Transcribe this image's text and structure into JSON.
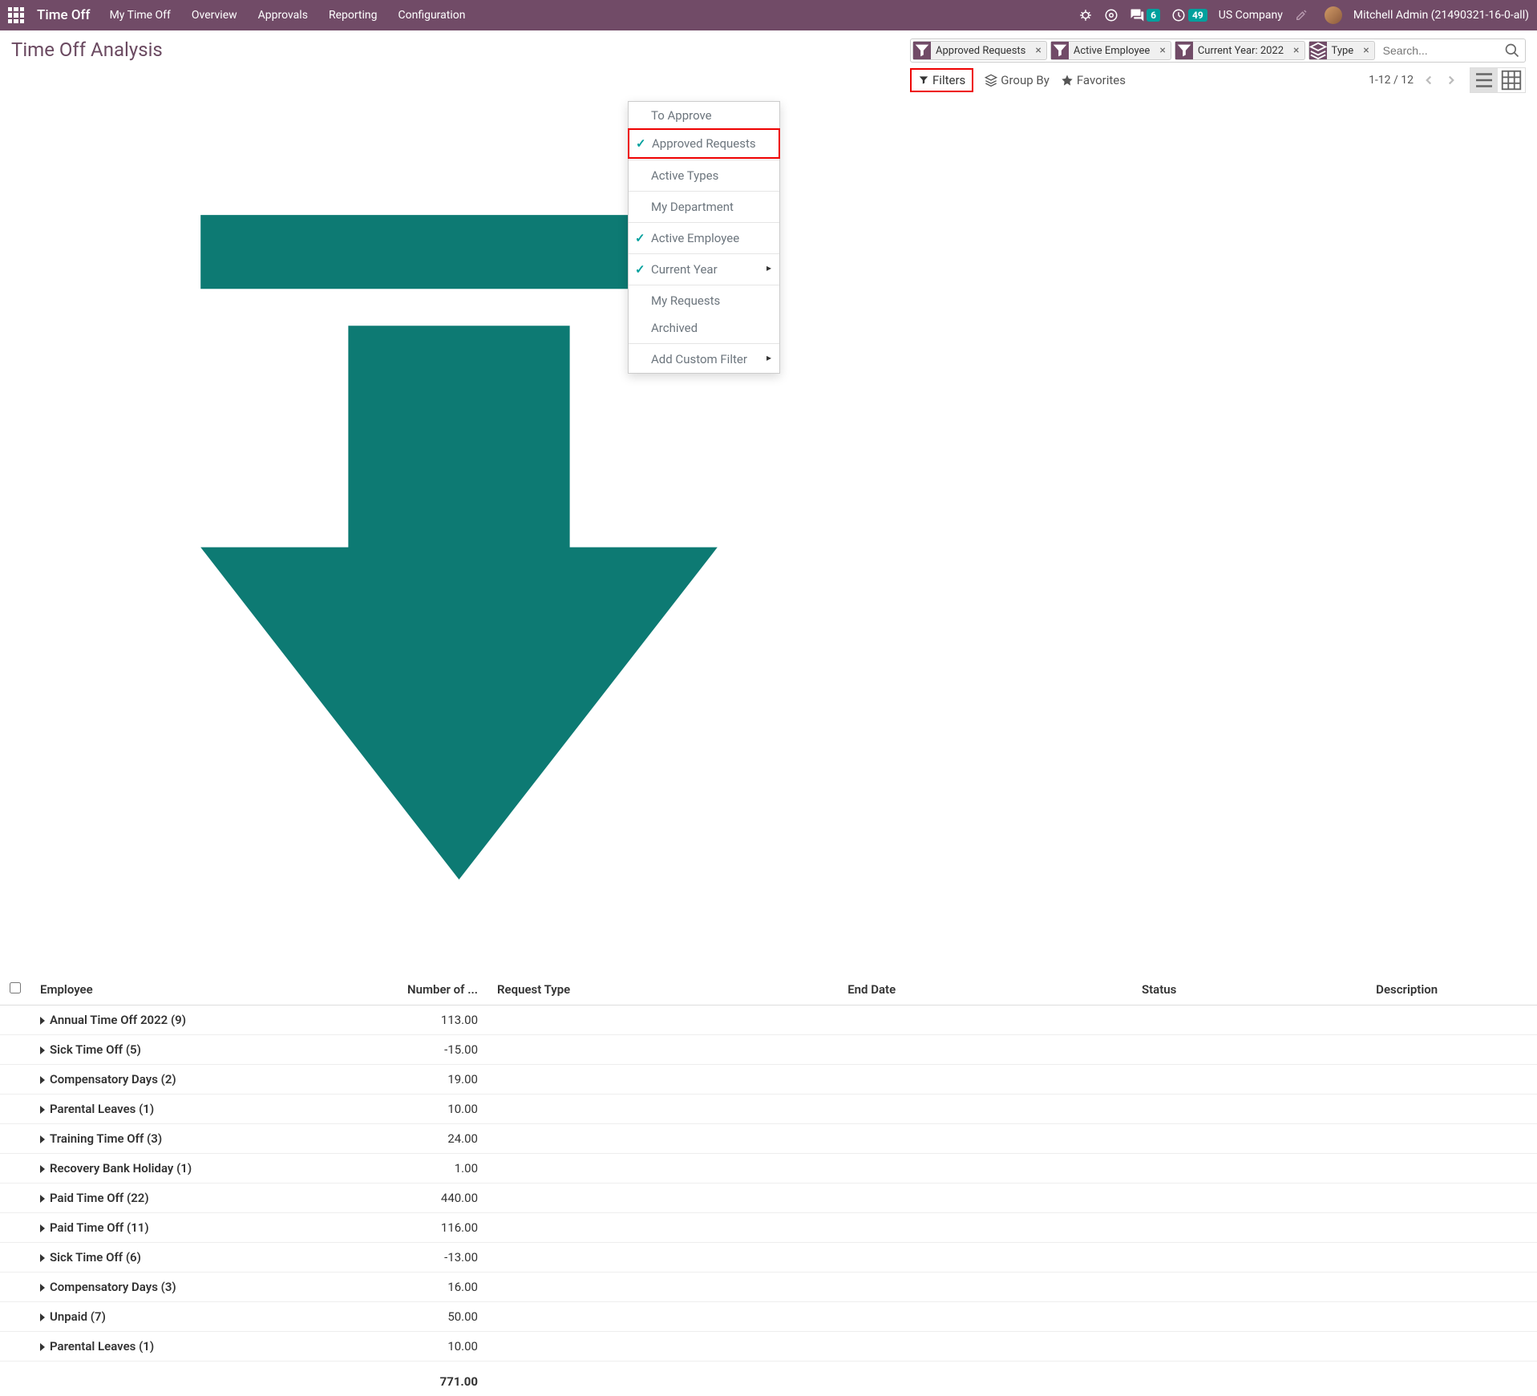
{
  "topbar": {
    "app_name": "Time Off",
    "menu": [
      "My Time Off",
      "Overview",
      "Approvals",
      "Reporting",
      "Configuration"
    ],
    "chat_count": "6",
    "activity_count": "49",
    "company": "US Company",
    "user": "Mitchell Admin (21490321-16-0-all)"
  },
  "page": {
    "title": "Time Off Analysis"
  },
  "search": {
    "facets": [
      {
        "type": "filter",
        "label": "Approved Requests"
      },
      {
        "type": "filter",
        "label": "Active Employee"
      },
      {
        "type": "filter",
        "label": "Current Year: 2022"
      },
      {
        "type": "group",
        "label": "Type"
      }
    ],
    "placeholder": "Search..."
  },
  "toolbar": {
    "filters_label": "Filters",
    "groupby_label": "Group By",
    "favorites_label": "Favorites",
    "pager": "1-12 / 12"
  },
  "filter_menu": {
    "items": [
      {
        "label": "To Approve",
        "checked": false
      },
      {
        "label": "Approved Requests",
        "checked": true,
        "highlight": true
      },
      {
        "sep": true
      },
      {
        "label": "Active Types",
        "checked": false
      },
      {
        "sep": true
      },
      {
        "label": "My Department",
        "checked": false
      },
      {
        "sep": true
      },
      {
        "label": "Active Employee",
        "checked": true
      },
      {
        "sep": true
      },
      {
        "label": "Current Year",
        "checked": true,
        "sub": true
      },
      {
        "sep": true
      },
      {
        "label": "My Requests",
        "checked": false
      },
      {
        "label": "Archived",
        "checked": false
      },
      {
        "sep": true
      },
      {
        "label": "Add Custom Filter",
        "checked": false,
        "sub": true
      }
    ]
  },
  "table": {
    "headers": [
      "Employee",
      "Number of ...",
      "Request Type",
      "End Date",
      "Status",
      "Description"
    ],
    "rows": [
      {
        "label": "Annual Time Off 2022 (9)",
        "value": "113.00"
      },
      {
        "label": "Sick Time Off (5)",
        "value": "-15.00"
      },
      {
        "label": "Compensatory Days (2)",
        "value": "19.00"
      },
      {
        "label": "Parental Leaves (1)",
        "value": "10.00"
      },
      {
        "label": "Training Time Off (3)",
        "value": "24.00"
      },
      {
        "label": "Recovery Bank Holiday (1)",
        "value": "1.00"
      },
      {
        "label": "Paid Time Off (22)",
        "value": "440.00"
      },
      {
        "label": "Paid Time Off (11)",
        "value": "116.00"
      },
      {
        "label": "Sick Time Off (6)",
        "value": "-13.00"
      },
      {
        "label": "Compensatory Days (3)",
        "value": "16.00"
      },
      {
        "label": "Unpaid (7)",
        "value": "50.00"
      },
      {
        "label": "Parental Leaves (1)",
        "value": "10.00"
      }
    ],
    "total": "771.00"
  }
}
